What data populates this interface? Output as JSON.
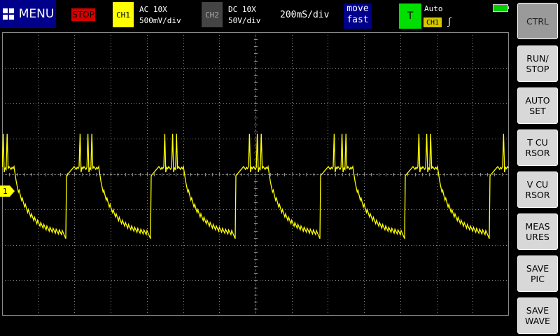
{
  "topbar": {
    "menu_label": "MENU",
    "run_state": "STOP",
    "ch1": {
      "badge": "CH1",
      "coupling": "AC 10X",
      "scale": "500mV/div"
    },
    "ch2": {
      "badge": "CH2",
      "coupling": "DC 10X",
      "scale": "50V/div"
    },
    "timebase": "200mS/div",
    "move": {
      "line1": "move",
      "line2": "fast"
    },
    "trigger": {
      "badge": "T",
      "mode": "Auto",
      "source": "CH1",
      "edge": "ʃ"
    }
  },
  "channel_marker": "1",
  "sidebar": {
    "buttons": [
      "CTRL",
      "RUN/\nSTOP",
      "AUTO\nSET",
      "T CU\nRSOR",
      "V CU\nRSOR",
      "MEAS\nURES",
      "SAVE\nPIC",
      "SAVE\nWAVE"
    ]
  },
  "colors": {
    "trace": "#ffff00",
    "grid": "#8a8a8a",
    "menu_bg": "#00008b",
    "stop_bg": "#d40000",
    "trigger_bg": "#00e000",
    "battery": "#00cc00"
  },
  "icons": {
    "menu": "grid-icon",
    "battery": "battery-icon"
  },
  "trace": {
    "waveform_pattern": "periodic sawtooth with spikes",
    "period_divisions": 2.0,
    "periods_visible": 6
  }
}
